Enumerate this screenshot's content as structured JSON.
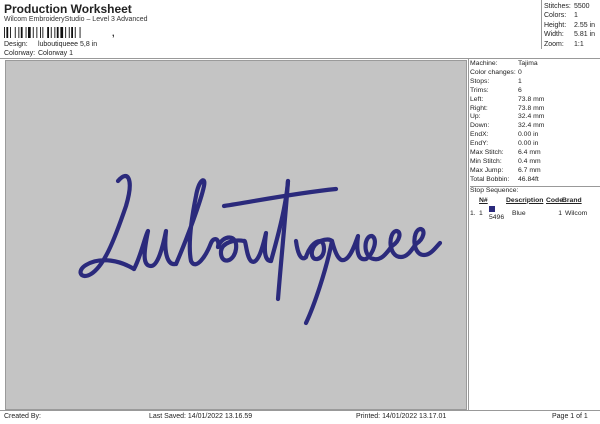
{
  "header": {
    "title": "Production Worksheet",
    "subtitle": "Wilcom EmbroideryStudio – Level 3 Advanced",
    "barcode_mark": ","
  },
  "meta": {
    "design_label": "Design:",
    "design_value": "luboutiqueee 5,8 in",
    "colorway_label": "Colorway:",
    "colorway_value": "Colorway 1"
  },
  "stats": [
    {
      "k": "Stitches:",
      "v": "5500"
    },
    {
      "k": "Colors:",
      "v": "1"
    },
    {
      "k": "Height:",
      "v": "2.55 in"
    },
    {
      "k": "Width:",
      "v": "5.81 in"
    },
    {
      "k": "Zoom:",
      "v": "1:1"
    }
  ],
  "design_text": "Luboutiqueee",
  "thread_color": "#2b2a7c",
  "details": [
    {
      "k": "Machine:",
      "v": "Tajima"
    },
    {
      "k": "Color changes:",
      "v": "0"
    },
    {
      "k": "Stops:",
      "v": "1"
    },
    {
      "k": "Trims:",
      "v": "6"
    },
    {
      "k": "Left:",
      "v": "73.8 mm"
    },
    {
      "k": "Right:",
      "v": "73.8 mm"
    },
    {
      "k": "Up:",
      "v": "32.4 mm"
    },
    {
      "k": "Down:",
      "v": "32.4 mm"
    },
    {
      "k": "EndX:",
      "v": "0.00 in"
    },
    {
      "k": "EndY:",
      "v": "0.00 in"
    },
    {
      "k": "Max Stitch:",
      "v": "6.4 mm"
    },
    {
      "k": "Min Stitch:",
      "v": "0.4 mm"
    },
    {
      "k": "Max Jump:",
      "v": "6.7 mm"
    },
    {
      "k": "Total Bobbin:",
      "v": "46.84ft"
    }
  ],
  "stop_sequence": {
    "label": "Stop Sequence:",
    "headers": {
      "n": "N#",
      "desc": "Description",
      "code": "Code",
      "brand": "Brand"
    },
    "rows": [
      {
        "idx": "1.",
        "n": "1",
        "num": "5496",
        "desc": "Blue",
        "code": "1",
        "brand": "Wilcom"
      }
    ]
  },
  "footer": {
    "created": "Created By:",
    "saved": "Last Saved: 14/01/2022 13.16.59",
    "printed": "Printed: 14/01/2022 13.17.01",
    "page": "Page 1 of 1"
  }
}
